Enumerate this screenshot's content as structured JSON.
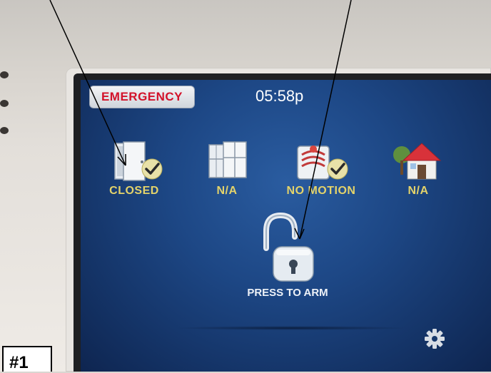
{
  "header": {
    "emergency_label": "EMERGENCY",
    "time": "05:58p"
  },
  "status_icons": [
    {
      "label": "CLOSED",
      "icon": "door-closed-icon",
      "checked": true
    },
    {
      "label": "N/A",
      "icon": "window-icon",
      "checked": false
    },
    {
      "label": "NO MOTION",
      "icon": "motion-sensor-icon",
      "checked": true
    },
    {
      "label": "N/A",
      "icon": "house-icon",
      "checked": false
    }
  ],
  "arm": {
    "label": "PRESS TO ARM",
    "icon": "unlocked-padlock-icon"
  },
  "settings_icon": "gear-icon",
  "photo_tag": "#1",
  "colors": {
    "emergency_text": "#d3122a",
    "status_label": "#e4d36a",
    "screen_bg": "#1d4785"
  }
}
